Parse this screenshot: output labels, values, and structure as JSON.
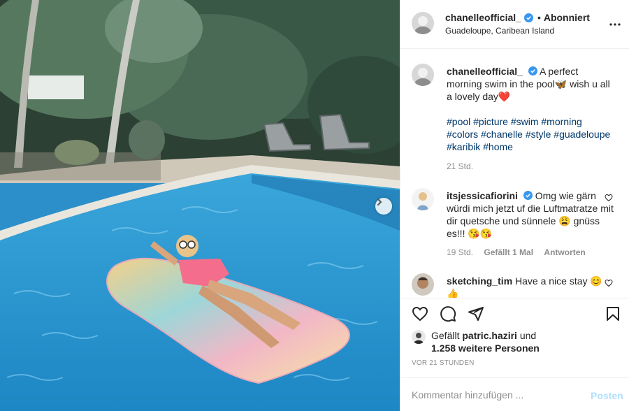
{
  "post": {
    "username": "chanelleofficial_",
    "follow_state": "Abonniert",
    "dot": "•",
    "location": "Guadeloupe, Caribean Island"
  },
  "caption": {
    "username": "chanelleofficial_",
    "text": "A perfect morning swim in the pool🦋 wish u all a lovely day❤️",
    "hashtags": "#pool #picture #swim #morning #colors #chanelle #style #guadeloupe #karibik #home",
    "time": "21 Std."
  },
  "comments": [
    {
      "username": "itsjessicafiorini",
      "text": "Omg wie gärn würdi mich jetzt uf die Luftmatratze mit dir quetsche und sünnele 😩 gnüss es!!! 😘😘",
      "time": "19 Std.",
      "likes": "Gefällt 1 Mal",
      "reply": "Antworten"
    },
    {
      "username": "sketching_tim",
      "text": "Have a nice stay 😊👍"
    }
  ],
  "likes": {
    "prefix": "Gefällt",
    "liker": "patric.haziri",
    "and": "und",
    "others": "1.258 weitere Personen"
  },
  "timeago": "VOR 21 STUNDEN",
  "comment_box": {
    "placeholder": "Kommentar hinzufügen ...",
    "post_label": "Posten"
  },
  "colors": {
    "link": "#00376b",
    "verified": "#3897f0",
    "post_disabled": "#b2dffc",
    "muted": "#8e8e8e"
  },
  "icons": [
    "next-arrow-icon",
    "more-icon",
    "verified-icon",
    "heart-icon",
    "comment-icon",
    "share-icon",
    "bookmark-icon"
  ]
}
